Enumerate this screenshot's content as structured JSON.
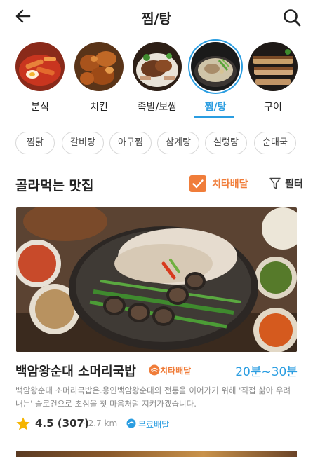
{
  "header": {
    "title": "찜/탕",
    "back_icon": "arrow-left-icon",
    "search_icon": "search-icon"
  },
  "categories": [
    {
      "label": "분식",
      "active": false
    },
    {
      "label": "치킨",
      "active": false
    },
    {
      "label": "족발/보쌈",
      "active": false
    },
    {
      "label": "찜/탕",
      "active": true
    },
    {
      "label": "구이",
      "active": false
    }
  ],
  "tags": [
    "찜닭",
    "갈비탕",
    "아구찜",
    "삼계탕",
    "설렁탕",
    "순대국"
  ],
  "section": {
    "title": "골라먹는 맛집",
    "cheetah_filter": "치타배달",
    "cheetah_checked": true,
    "filter_label": "필터"
  },
  "restaurant": {
    "name": "백암왕순대 소머리국밥",
    "badge": "치타배달",
    "delivery_time": "20분~30분",
    "description": "백암왕순대 소머리국밥은.용인백암왕순대의 전통을 이어가기 위해 '직접 삶아 우려내는' 슬로건으로 초심을 첫 마음처럼 지켜가겠습니다.",
    "rating": "4.5 (307)",
    "distance": "· 2.7 km",
    "free_delivery": "무료배달"
  },
  "colors": {
    "accent_blue": "#2a9de1",
    "accent_orange": "#f07d3a"
  }
}
